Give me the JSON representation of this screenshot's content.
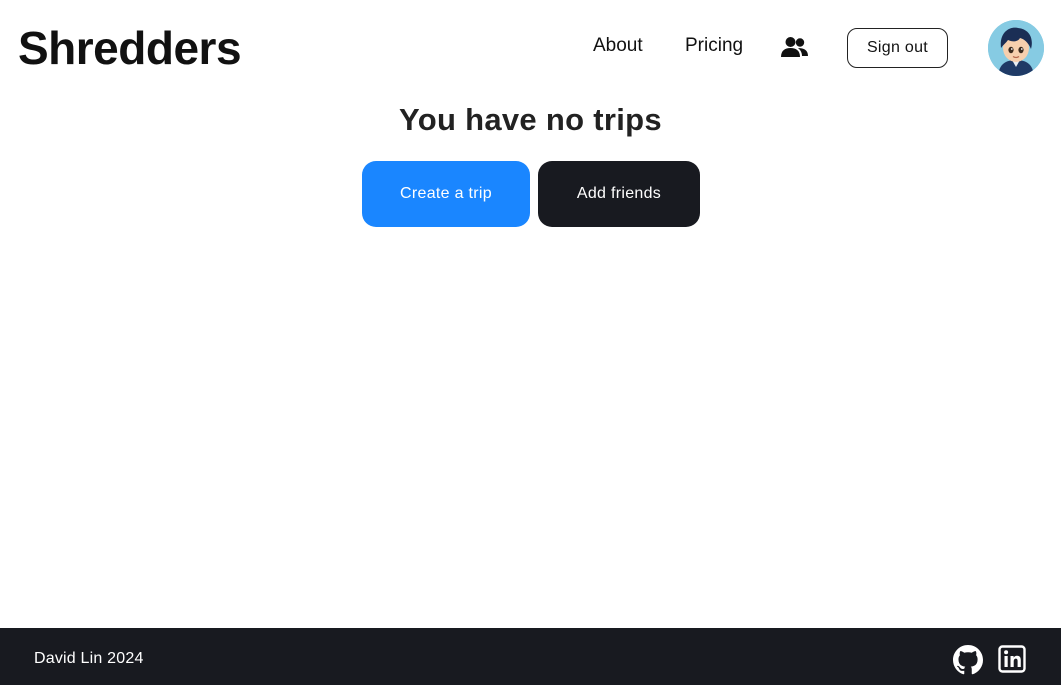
{
  "header": {
    "logo": "Shredders",
    "nav": {
      "about": "About",
      "pricing": "Pricing"
    },
    "friends_icon": "users-icon",
    "signout_label": "Sign out",
    "avatar_icon": "user-avatar"
  },
  "main": {
    "title": "You have no trips",
    "create_label": "Create a trip",
    "friends_label": "Add friends"
  },
  "footer": {
    "text": "David Lin 2024",
    "icons": [
      "github-icon",
      "linkedin-icon"
    ]
  },
  "colors": {
    "primary": "#1a86ff",
    "dark": "#181a20",
    "background": "#ffffff"
  }
}
